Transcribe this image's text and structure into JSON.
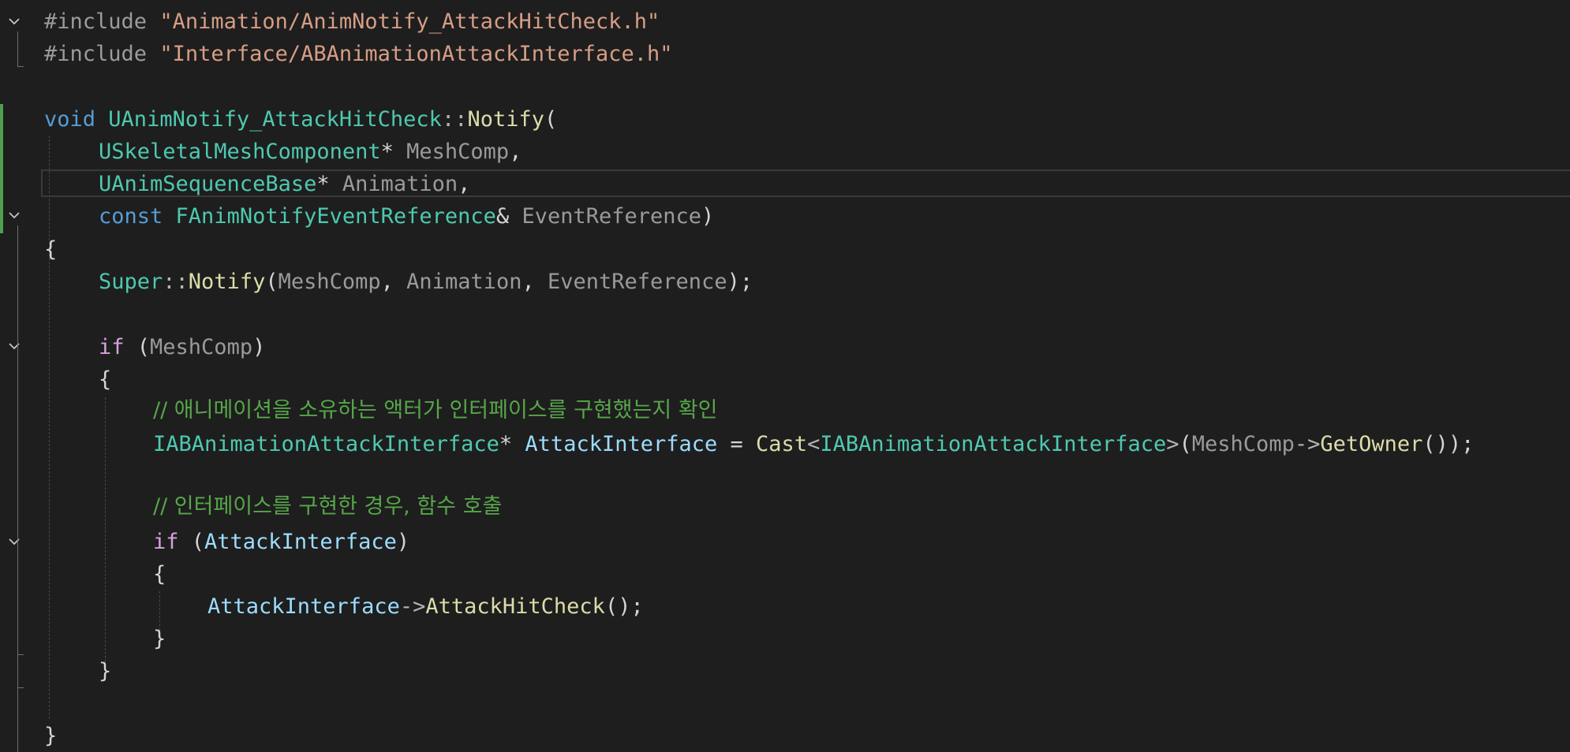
{
  "colors": {
    "background": "#1e1e1e",
    "keyword": "#569cd6",
    "control_keyword": "#d8a0df",
    "type": "#4ec9b0",
    "function": "#dcdcaa",
    "string": "#d69d85",
    "comment": "#57a64a",
    "parameter": "#9a9a9a",
    "variable": "#9cdcfe",
    "preprocessor": "#9b9b9b",
    "change_marker": "#4ea04f"
  },
  "icons": {
    "fold": "chevron-down-icon"
  },
  "code": {
    "l1": {
      "directive": "#include",
      "sp": " ",
      "path": "\"Animation/AnimNotify_AttackHitCheck.h\""
    },
    "l2": {
      "directive": "#include",
      "sp": " ",
      "path": "\"Interface/ABAnimationAttackInterface.h\""
    },
    "l4": {
      "kw": "void",
      "sp": " ",
      "cls": "UAnimNotify_AttackHitCheck",
      "scope": "::",
      "fn": "Notify",
      "open": "("
    },
    "l5": {
      "type": "USkeletalMeshComponent",
      "mod": "* ",
      "param": "MeshComp",
      "end": ","
    },
    "l6": {
      "type": "UAnimSequenceBase",
      "mod": "* ",
      "param": "Animation",
      "end": ","
    },
    "l7": {
      "kw": "const",
      "sp": " ",
      "type": "FAnimNotifyEventReference",
      "mod": "& ",
      "param": "EventReference",
      "end": ")"
    },
    "l8": {
      "brace": "{"
    },
    "l9": {
      "cls": "Super",
      "scope": "::",
      "fn": "Notify",
      "open": "(",
      "a1": "MeshComp",
      "c1": ", ",
      "a2": "Animation",
      "c2": ", ",
      "a3": "EventReference",
      "end": ");"
    },
    "l11": {
      "kw": "if",
      "open": " (",
      "param": "MeshComp",
      "close": ")"
    },
    "l12": {
      "brace": "{"
    },
    "l13": {
      "comment": "// 애니메이션을 소유하는 액터가 인터페이스를 구현했는지 확인"
    },
    "l14": {
      "type": "IABAnimationAttackInterface",
      "mod": "* ",
      "var": "AttackInterface",
      "eq": " = ",
      "fn": "Cast",
      "lt": "<",
      "type2": "IABAnimationAttackInterface",
      "gt": ">",
      "open": "(",
      "param": "MeshComp",
      "arrow": "->",
      "fn2": "GetOwner",
      "end": "());"
    },
    "l16": {
      "comment": "// 인터페이스를 구현한 경우, 함수 호출"
    },
    "l17": {
      "kw": "if",
      "open": " (",
      "var": "AttackInterface",
      "close": ")"
    },
    "l18": {
      "brace": "{"
    },
    "l19": {
      "var": "AttackInterface",
      "arrow": "->",
      "fn": "AttackHitCheck",
      "end": "();"
    },
    "l20": {
      "brace": "}"
    },
    "l21": {
      "brace": "}"
    },
    "l23": {
      "brace": "}"
    }
  }
}
